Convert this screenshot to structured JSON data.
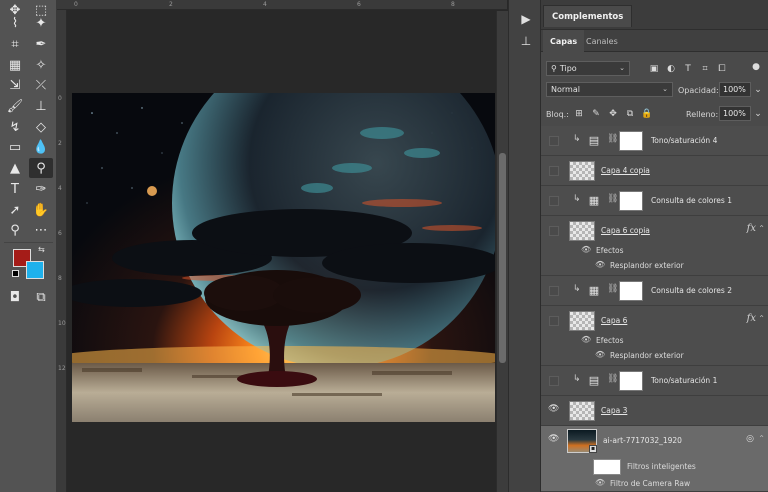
{
  "colors": {
    "foreground": "#a51c18",
    "background": "#1eb1ec",
    "accent": "#1473e6"
  },
  "toolbar": {
    "tools": [
      "move-icon",
      "marquee-icon",
      "lasso-icon",
      "magic-wand-icon",
      "crop-icon",
      "eyedropper-icon",
      "healing-brush-icon",
      "patch-icon",
      "brush-icon",
      "clone-stamp-icon",
      "history-brush-icon",
      "eraser-icon",
      "gradient-icon",
      "blur-icon",
      "smudge-icon",
      "zoom-icon",
      "pen-icon",
      "text-icon",
      "path-select-icon",
      "hand-icon",
      "zoom-tool-icon",
      "more-icon"
    ]
  },
  "rulers": {
    "top": [
      "0",
      "2",
      "4",
      "6",
      "8"
    ],
    "left": [
      "0",
      "2",
      "4",
      "6",
      "8",
      "10",
      "12"
    ]
  },
  "panel": {
    "complementos_tab": "Complementos",
    "tabs": [
      "Capas",
      "Canales"
    ],
    "filter_kind": "Tipo",
    "blend_mode": "Normal",
    "opacity_label": "Opacidad:",
    "opacity_value": "100%",
    "lock_label": "Bloq.:",
    "fill_label": "Relleno:",
    "fill_value": "100%"
  },
  "layers": [
    {
      "name": "Tono/saturación 4",
      "type": "adjustment",
      "icon": "levels-icon",
      "visible": false,
      "clipped": true
    },
    {
      "name": "Capa 4 copia",
      "type": "pixel",
      "visible": false,
      "clipped": false,
      "link": true
    },
    {
      "name": "Consulta de colores 1",
      "type": "adjustment",
      "icon": "grid-icon",
      "visible": false,
      "clipped": true
    },
    {
      "name": "Capa 6 copia",
      "type": "pixel",
      "visible": false,
      "clipped": false,
      "link": true,
      "fx": "fx"
    },
    {
      "name": "Consulta de colores 2",
      "type": "adjustment",
      "icon": "grid-icon",
      "visible": false,
      "clipped": true
    },
    {
      "name": "Capa 6",
      "type": "pixel",
      "visible": false,
      "clipped": false,
      "link": true,
      "fx": "fx"
    },
    {
      "name": "Tono/saturación 1",
      "type": "adjustment",
      "icon": "levels-icon",
      "visible": false,
      "clipped": true
    },
    {
      "name": "Capa 3",
      "type": "pixel",
      "visible": true,
      "clipped": false,
      "link": true
    },
    {
      "name": "ai-art-7717032_1920",
      "type": "smart",
      "visible": true,
      "clipped": false
    }
  ],
  "effects": {
    "label": "Efectos",
    "glow": "Resplandor exterior"
  },
  "smart_filters": {
    "label": "Filtros inteligentes",
    "camera_raw": "Filtro de Camera Raw"
  }
}
